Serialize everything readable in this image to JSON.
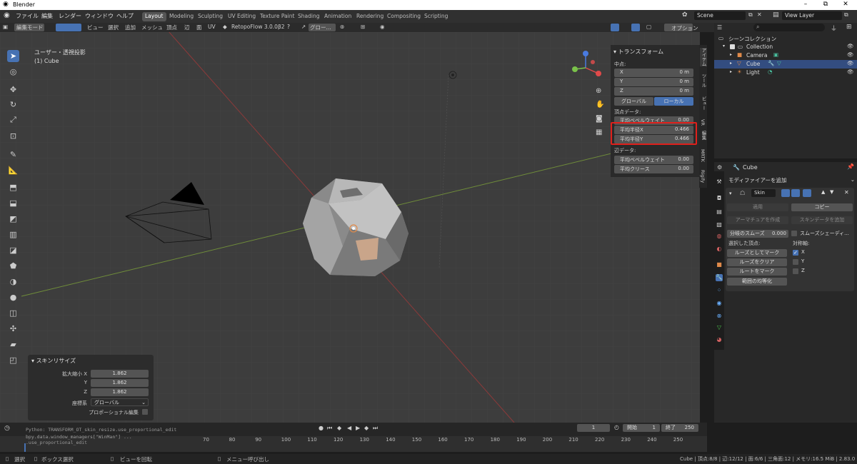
{
  "window": {
    "title": "Blender",
    "min": "–",
    "max": "⧉",
    "close": "✕"
  },
  "menu": [
    "ファイル",
    "編集",
    "レンダー",
    "ウィンドウ",
    "ヘルプ"
  ],
  "workspaces": [
    "Layout",
    "Modeling",
    "Sculpting",
    "UV Editing",
    "Texture Paint",
    "Shading",
    "Animation",
    "Rendering",
    "Compositing",
    "Scripting"
  ],
  "scene": {
    "name": "Scene",
    "view_layer": "View Layer"
  },
  "header": {
    "mode": "編集モード",
    "items": [
      "ビュー",
      "選択",
      "追加",
      "メッシュ",
      "頂点",
      "辺",
      "面",
      "UV"
    ],
    "addon": "RetopoFlow 3.0.0β2",
    "orientation": "グロー...",
    "options": "オプション"
  },
  "viewport": {
    "view_name": "ユーザー・透視投影",
    "object": "(1) Cube"
  },
  "npanel": {
    "title": "トランスフォーム",
    "median_label": "中点:",
    "median": [
      {
        "k": "X",
        "v": "0 m"
      },
      {
        "k": "Y",
        "v": "0 m"
      },
      {
        "k": "Z",
        "v": "0 m"
      }
    ],
    "global_btn": "グローバル",
    "local_btn": "ローカル",
    "vertex_label": "頂点データ:",
    "bevel_weight": {
      "k": "平均ベベルウェイト",
      "v": "0.00"
    },
    "radius_x": {
      "k": "平均半径X",
      "v": "0.466"
    },
    "radius_y": {
      "k": "平均半径Y",
      "v": "0.466"
    },
    "edge_label": "辺データ:",
    "edge_bevel": {
      "k": "平均ベベルウェイト",
      "v": "0.00"
    },
    "edge_crease": {
      "k": "平均クリース",
      "v": "0.00"
    },
    "tabs": [
      "アイテム",
      "ツール",
      "ビュー",
      "VR",
      "編集",
      "MRTK",
      "Rigify"
    ]
  },
  "outliner": {
    "header": "シーンコレクション",
    "collection": "Collection",
    "items": [
      "Camera",
      "Cube",
      "Light"
    ]
  },
  "properties": {
    "object_name": "Cube",
    "add_modifier": "モディファイアーを追加",
    "modifier_name": "Skin",
    "apply": "適用",
    "copy": "コピー",
    "create_armature": "アーマチュアを作成",
    "add_skin_data": "スキンデータを追加",
    "branch_smooth": "分岐のスムーズ",
    "branch_value": "0.000",
    "smooth_shading": "スムーズシェーディ...",
    "selected_vertices": "選択した頂点:",
    "symmetry": "対称軸:",
    "mark_loose": "ルーズとしてマーク",
    "clear_loose": "ルーズをクリア",
    "mark_root": "ルートをマーク",
    "equalize": "範囲の均等化",
    "axes": [
      "X",
      "Y",
      "Z"
    ]
  },
  "redo_panel": {
    "title": "スキンリサイズ",
    "scale_label": "拡大縮小 X",
    "x": "1.862",
    "y_label": "Y",
    "y": "1.862",
    "z_label": "Z",
    "z": "1.862",
    "orient_label": "座標系",
    "orient_value": "グローバル",
    "prop_edit": "プロポーショナル編集"
  },
  "info": {
    "line1": "Python: TRANSFORM_OT_skin_resize.use_proportional_edit",
    "line2": "bpy.data.window_managers[\"WinMan\"] ... .use_proportional_edit"
  },
  "timeline": {
    "frame": "1",
    "start_label": "開始",
    "start": "1",
    "end_label": "終了",
    "end": "250",
    "ticks": [
      "70",
      "80",
      "90",
      "100",
      "110",
      "120",
      "130",
      "140",
      "150",
      "160",
      "170",
      "180",
      "190",
      "200",
      "210",
      "220",
      "230",
      "240",
      "250"
    ]
  },
  "status": {
    "select": "選択",
    "box_select": "ボックス選択",
    "rotate_view": "ビューを回転",
    "call_menu": "メニュー呼び出し",
    "stats": "Cube | 頂点:8/8 | 辺:12/12 | 面:6/6 | 三角面:12 | メモリ:16.5 MiB | 2.83.0"
  },
  "colors": {
    "accent": "#4772b3",
    "highlight": "#e0201b",
    "grid_x": "#8c3a3a",
    "grid_y": "#6f8c3a"
  }
}
